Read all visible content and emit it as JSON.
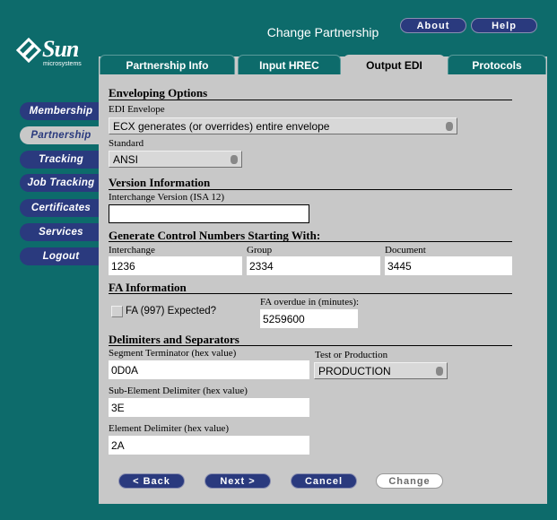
{
  "logo": {
    "name": "Sun",
    "sub": "microsystems"
  },
  "window": {
    "title": "Change Partnership"
  },
  "header_buttons": {
    "about": "About",
    "help": "Help"
  },
  "nav": [
    {
      "label": "Membership"
    },
    {
      "label": "Partnership"
    },
    {
      "label": "Tracking"
    },
    {
      "label": "Job Tracking"
    },
    {
      "label": "Certificates"
    },
    {
      "label": "Services"
    },
    {
      "label": "Logout"
    }
  ],
  "tabs": [
    {
      "label": "Partnership Info"
    },
    {
      "label": "Input HREC"
    },
    {
      "label": "Output EDI"
    },
    {
      "label": "Protocols"
    }
  ],
  "enveloping": {
    "heading": "Enveloping Options",
    "edi_envelope_label": "EDI Envelope",
    "edi_envelope_value": "ECX generates (or overrides) entire envelope",
    "standard_label": "Standard",
    "standard_value": "ANSI"
  },
  "version": {
    "heading": "Version Information",
    "interchange_version_label": "Interchange Version (ISA 12)",
    "interchange_version_value": ""
  },
  "control_numbers": {
    "heading": "Generate Control Numbers Starting With:",
    "interchange_label": "Interchange",
    "interchange_value": "1236",
    "group_label": "Group",
    "group_value": "2334",
    "document_label": "Document",
    "document_value": "3445"
  },
  "fa": {
    "heading": "FA Information",
    "expected_label": "FA (997) Expected?",
    "overdue_label": "FA overdue in (minutes):",
    "overdue_value": "5259600"
  },
  "delimiters": {
    "heading": "Delimiters and Separators",
    "segment_label": "Segment Terminator (hex value)",
    "segment_value": "0D0A",
    "test_prod_label": "Test or Production",
    "test_prod_value": "PRODUCTION",
    "subelement_label": "Sub-Element Delimiter (hex value)",
    "subelement_value": "3E",
    "element_label": "Element Delimiter (hex value)",
    "element_value": "2A"
  },
  "actions": {
    "back": "< Back",
    "next": "Next >",
    "cancel": "Cancel",
    "change": "Change"
  },
  "colors": {
    "background": "#0d6b6b",
    "panel": "#c8c8c8",
    "button": "#2a3a7e"
  }
}
